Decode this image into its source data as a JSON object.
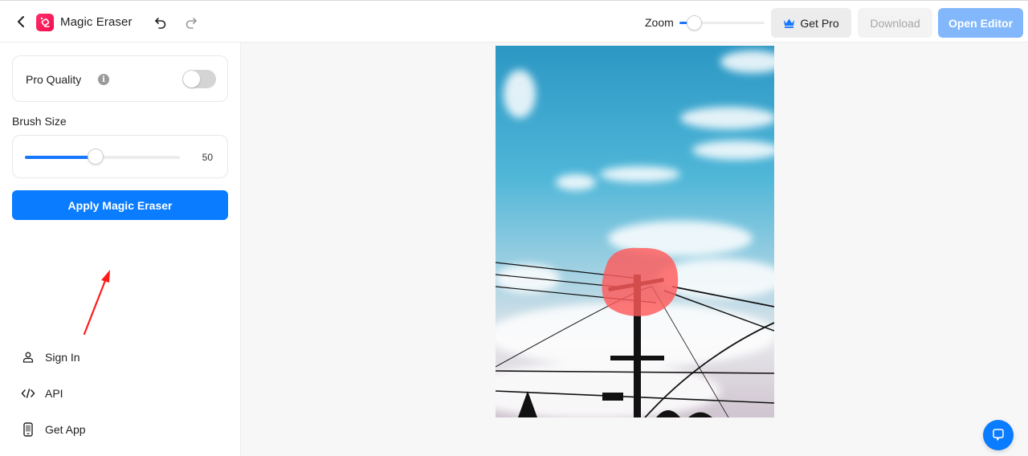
{
  "header": {
    "app_title": "Magic Eraser",
    "zoom_label": "Zoom",
    "zoom_level": 0.1,
    "get_pro_label": "Get Pro",
    "download_label": "Download",
    "open_editor_label": "Open Editor",
    "accent_color": "#1677ff"
  },
  "sidebar": {
    "pro_quality_label": "Pro Quality",
    "pro_quality_enabled": false,
    "info_glyph": "i",
    "brush_size_label": "Brush Size",
    "brush_size_value": "50",
    "brush_size_fraction": 0.45,
    "apply_label": "Apply Magic Eraser",
    "nav": [
      {
        "label": "Sign In",
        "icon": "user-icon"
      },
      {
        "label": "API",
        "icon": "code-icon"
      },
      {
        "label": "Get App",
        "icon": "phone-icon"
      }
    ]
  },
  "canvas": {
    "image_description": "Sky with clouds and a utility pole with power lines; red brush mask over pole top",
    "mask_color": "#ff5a5a"
  }
}
